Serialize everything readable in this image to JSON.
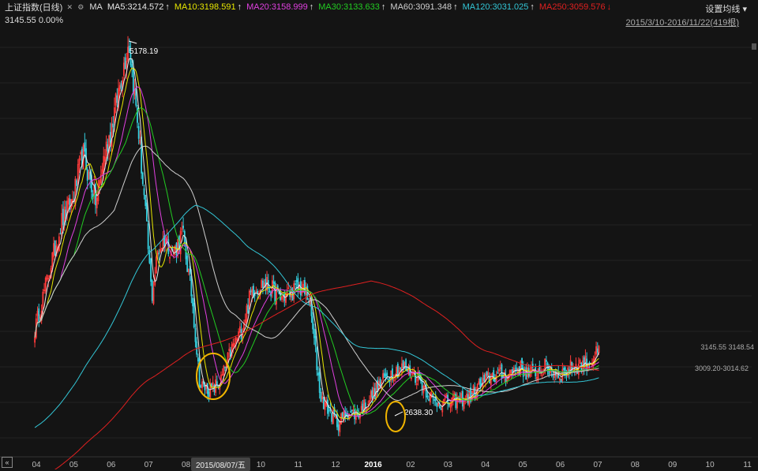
{
  "legend": {
    "title": "上证指数(日线)",
    "indicator": "MA",
    "ma_items": [
      {
        "label": "MA5:3214.572",
        "arrow": "↑",
        "color": "#e8e8e8"
      },
      {
        "label": "MA10:3198.591",
        "arrow": "↑",
        "color": "#e6e600"
      },
      {
        "label": "MA20:3158.999",
        "arrow": "↑",
        "color": "#e040e0"
      },
      {
        "label": "MA30:3133.633",
        "arrow": "↑",
        "color": "#22cc22"
      },
      {
        "label": "MA60:3091.348",
        "arrow": "↑",
        "color": "#cfcfcf"
      },
      {
        "label": "MA120:3031.025",
        "arrow": "↑",
        "color": "#33c6d6"
      },
      {
        "label": "MA250:3059.576",
        "arrow": "↓",
        "color": "#e02020"
      }
    ]
  },
  "settings_label": "设置均线",
  "date_range": "2015/3/10-2016/11/22(419根)",
  "current_price": "3145.55 0.00%",
  "cursor_date": "2015/08/07/五",
  "annotations": {
    "high": "5178.19",
    "low": "2638.30",
    "right_top": "3145.55 3148.54",
    "right_bottom": "3009.20-3014.62"
  },
  "chart_data": {
    "type": "candlestick",
    "x_tick_labels": [
      "04",
      "05",
      "06",
      "07",
      "08",
      "09",
      "10",
      "11",
      "12",
      "2016",
      "02",
      "03",
      "04",
      "05",
      "06",
      "07",
      "08",
      "09",
      "10",
      "11"
    ],
    "ylim": [
      2500,
      5250
    ],
    "close_anchors": [
      {
        "m": 0.0,
        "v": 3290
      },
      {
        "m": 0.4,
        "v": 3700
      },
      {
        "m": 0.7,
        "v": 4000
      },
      {
        "m": 1.0,
        "v": 4150
      },
      {
        "m": 1.25,
        "v": 4450
      },
      {
        "m": 1.4,
        "v": 4300
      },
      {
        "m": 1.6,
        "v": 4120
      },
      {
        "m": 1.8,
        "v": 4420
      },
      {
        "m": 2.0,
        "v": 4620
      },
      {
        "m": 2.3,
        "v": 5000
      },
      {
        "m": 2.45,
        "v": 5178
      },
      {
        "m": 2.7,
        "v": 4600
      },
      {
        "m": 2.9,
        "v": 4000
      },
      {
        "m": 3.05,
        "v": 3500
      },
      {
        "m": 3.2,
        "v": 3800
      },
      {
        "m": 3.4,
        "v": 3900
      },
      {
        "m": 3.6,
        "v": 3780
      },
      {
        "m": 3.85,
        "v": 3930
      },
      {
        "m": 4.1,
        "v": 3500
      },
      {
        "m": 4.3,
        "v": 2930
      },
      {
        "m": 4.6,
        "v": 2900
      },
      {
        "m": 4.85,
        "v": 2960
      },
      {
        "m": 5.1,
        "v": 3150
      },
      {
        "m": 5.4,
        "v": 3300
      },
      {
        "m": 5.65,
        "v": 3550
      },
      {
        "m": 6.0,
        "v": 3600
      },
      {
        "m": 6.4,
        "v": 3500
      },
      {
        "m": 6.9,
        "v": 3570
      },
      {
        "m": 7.15,
        "v": 3500
      },
      {
        "m": 7.45,
        "v": 2850
      },
      {
        "m": 7.7,
        "v": 2750
      },
      {
        "m": 7.9,
        "v": 2680
      },
      {
        "m": 8.15,
        "v": 2760
      },
      {
        "m": 8.4,
        "v": 2740
      },
      {
        "m": 8.8,
        "v": 2870
      },
      {
        "m": 9.2,
        "v": 3000
      },
      {
        "m": 9.6,
        "v": 3050
      },
      {
        "m": 10.0,
        "v": 2980
      },
      {
        "m": 10.4,
        "v": 2820
      },
      {
        "m": 10.8,
        "v": 2820
      },
      {
        "m": 11.3,
        "v": 2850
      },
      {
        "m": 11.6,
        "v": 2930
      },
      {
        "m": 11.9,
        "v": 2990
      },
      {
        "m": 12.3,
        "v": 3000
      },
      {
        "m": 12.6,
        "v": 3050
      },
      {
        "m": 12.9,
        "v": 3000
      },
      {
        "m": 13.3,
        "v": 3050
      },
      {
        "m": 13.7,
        "v": 3000
      },
      {
        "m": 14.0,
        "v": 3050
      },
      {
        "m": 14.4,
        "v": 3080
      },
      {
        "m": 14.7,
        "v": 3145
      }
    ],
    "ma_periods": [
      5,
      10,
      20,
      30,
      60,
      120,
      250
    ]
  }
}
